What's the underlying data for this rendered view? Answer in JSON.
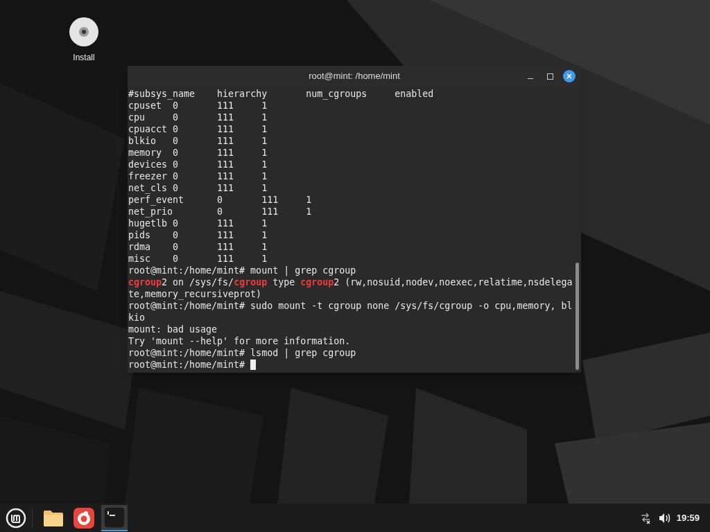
{
  "desktop_icons": [
    {
      "label": "Install"
    }
  ],
  "window": {
    "title": "root@mint: /home/mint",
    "lines": [
      {
        "segments": [
          {
            "text": "#subsys_name\thierarchy\tnum_cgroups\tenabled",
            "kind": "plain"
          }
        ]
      },
      {
        "segments": [
          {
            "text": "cpuset\t0\t111\t1",
            "kind": "plain"
          }
        ]
      },
      {
        "segments": [
          {
            "text": "cpu\t0\t111\t1",
            "kind": "plain"
          }
        ]
      },
      {
        "segments": [
          {
            "text": "cpuacct\t0\t111\t1",
            "kind": "plain"
          }
        ]
      },
      {
        "segments": [
          {
            "text": "blkio\t0\t111\t1",
            "kind": "plain"
          }
        ]
      },
      {
        "segments": [
          {
            "text": "memory\t0\t111\t1",
            "kind": "plain"
          }
        ]
      },
      {
        "segments": [
          {
            "text": "devices\t0\t111\t1",
            "kind": "plain"
          }
        ]
      },
      {
        "segments": [
          {
            "text": "freezer\t0\t111\t1",
            "kind": "plain"
          }
        ]
      },
      {
        "segments": [
          {
            "text": "net_cls\t0\t111\t1",
            "kind": "plain"
          }
        ]
      },
      {
        "segments": [
          {
            "text": "perf_event\t0\t111\t1",
            "kind": "plain"
          }
        ]
      },
      {
        "segments": [
          {
            "text": "net_prio\t0\t111\t1",
            "kind": "plain"
          }
        ]
      },
      {
        "segments": [
          {
            "text": "hugetlb\t0\t111\t1",
            "kind": "plain"
          }
        ]
      },
      {
        "segments": [
          {
            "text": "pids\t0\t111\t1",
            "kind": "plain"
          }
        ]
      },
      {
        "segments": [
          {
            "text": "rdma\t0\t111\t1",
            "kind": "plain"
          }
        ]
      },
      {
        "segments": [
          {
            "text": "misc\t0\t111\t1",
            "kind": "plain"
          }
        ]
      },
      {
        "segments": [
          {
            "text": "root@mint:/home/mint# mount | grep cgroup",
            "kind": "plain"
          }
        ]
      },
      {
        "segments": [
          {
            "text": "cgroup",
            "kind": "match"
          },
          {
            "text": "2 on /sys/fs/",
            "kind": "plain"
          },
          {
            "text": "cgroup",
            "kind": "match"
          },
          {
            "text": " type ",
            "kind": "plain"
          },
          {
            "text": "cgroup",
            "kind": "match"
          },
          {
            "text": "2 (rw,nosuid,nodev,noexec,relatime,nsdelega",
            "kind": "plain"
          }
        ]
      },
      {
        "segments": [
          {
            "text": "te,memory_recursiveprot)",
            "kind": "plain"
          }
        ]
      },
      {
        "segments": [
          {
            "text": "root@mint:/home/mint# sudo mount -t cgroup none /sys/fs/cgroup -o cpu,memory, bl",
            "kind": "plain"
          }
        ]
      },
      {
        "segments": [
          {
            "text": "kio",
            "kind": "plain"
          }
        ]
      },
      {
        "segments": [
          {
            "text": "mount: bad usage",
            "kind": "plain"
          }
        ]
      },
      {
        "segments": [
          {
            "text": "Try 'mount --help' for more information.",
            "kind": "plain"
          }
        ]
      },
      {
        "segments": [
          {
            "text": "root@mint:/home/mint# lsmod | grep cgroup",
            "kind": "plain"
          }
        ]
      },
      {
        "segments": [
          {
            "text": "root@mint:/home/mint#",
            "kind": "plain"
          }
        ],
        "cursor": true
      }
    ]
  },
  "taskbar": {
    "apps": [
      {
        "kind": "files",
        "active": false
      },
      {
        "kind": "browser",
        "active": false
      },
      {
        "kind": "terminal",
        "active": true
      }
    ],
    "clock": "19:59"
  }
}
